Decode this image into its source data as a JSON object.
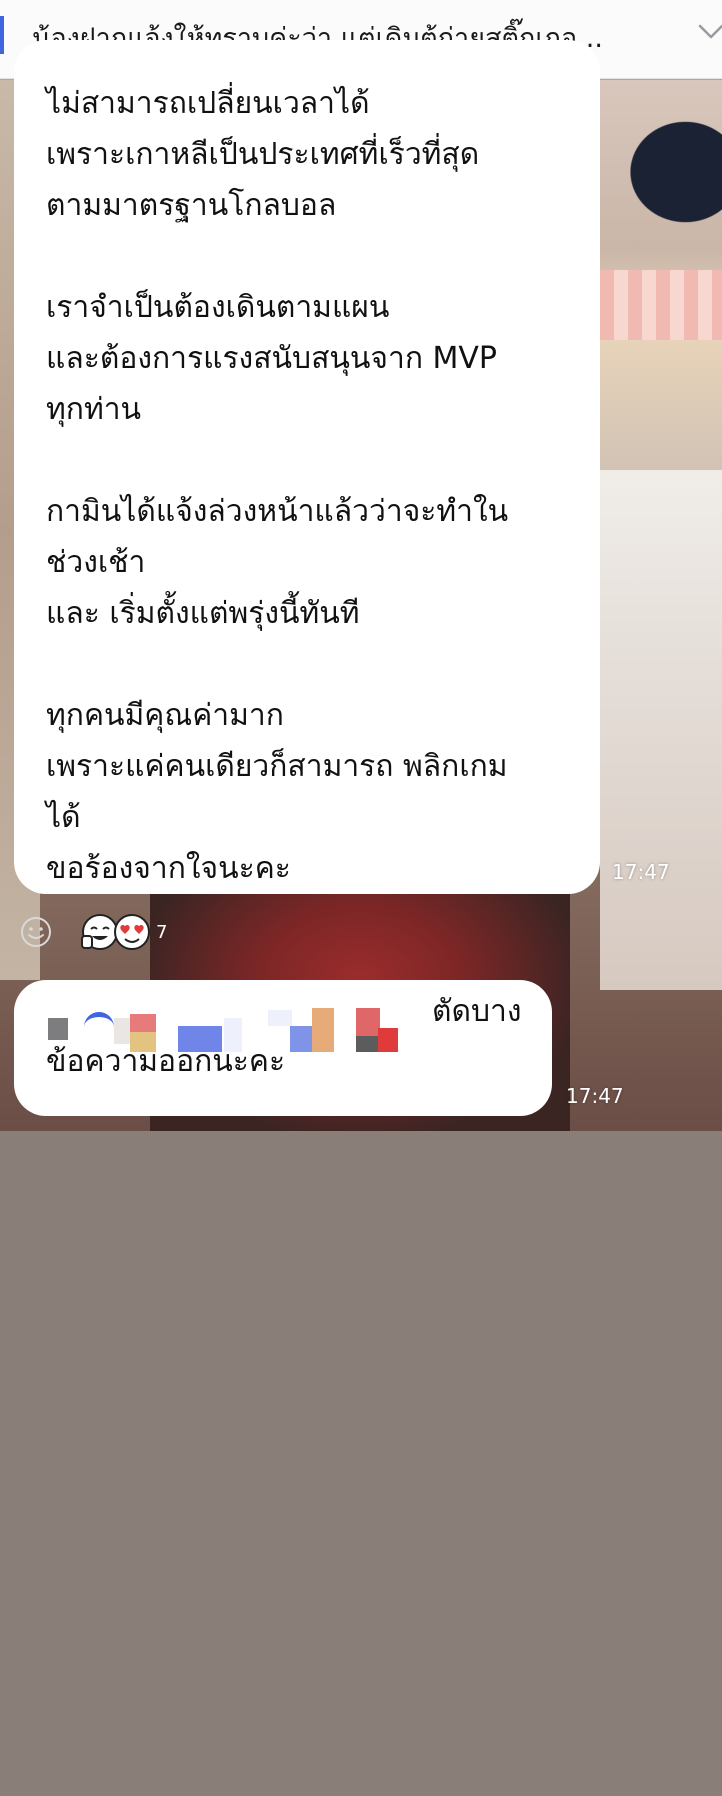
{
  "notice": {
    "text": "น้องฝากแจ้งให้ทราบค่ะว่า แต่เดิมตู้ถ่ายสติ๊กเกอ...",
    "icon": "chevron-down-icon"
  },
  "messages": [
    {
      "text": "ไม่สามารถเปลี่ยนเวลาได้\nเพราะเกาหลีเป็นประเทศที่เร็วที่สุด\nตามมาตรฐานโกลบอล\n\nเราจำเป็นต้องเดินตามแผน\nและต้องการแรงสนับสนุนจาก MVP\nทุกท่าน\n\nกามินได้แจ้งล่วงหน้าแล้วว่าจะทำใน\nช่วงเช้า\nและ เริ่มตั้งแต่พรุ่งนี้ทันที\n\nทุกคนมีคุณค่ามาก\nเพราะแค่คนเดียวก็สามารถ พลิกเกม\nได้\nขอร้องจากใจนะคะ",
      "time": "17:47"
    },
    {
      "line1_tail": "ตัดบาง",
      "line2": "ข้อความออกนะคะ",
      "time": "17:47"
    }
  ],
  "reactions": {
    "add_icon": "smiley-add-icon",
    "emojis": [
      "thumbs-up-face-icon",
      "heart-eyes-face-icon"
    ],
    "count": "7"
  },
  "colors": {
    "accent": "#3f65e0",
    "bubble": "#ffffff"
  }
}
